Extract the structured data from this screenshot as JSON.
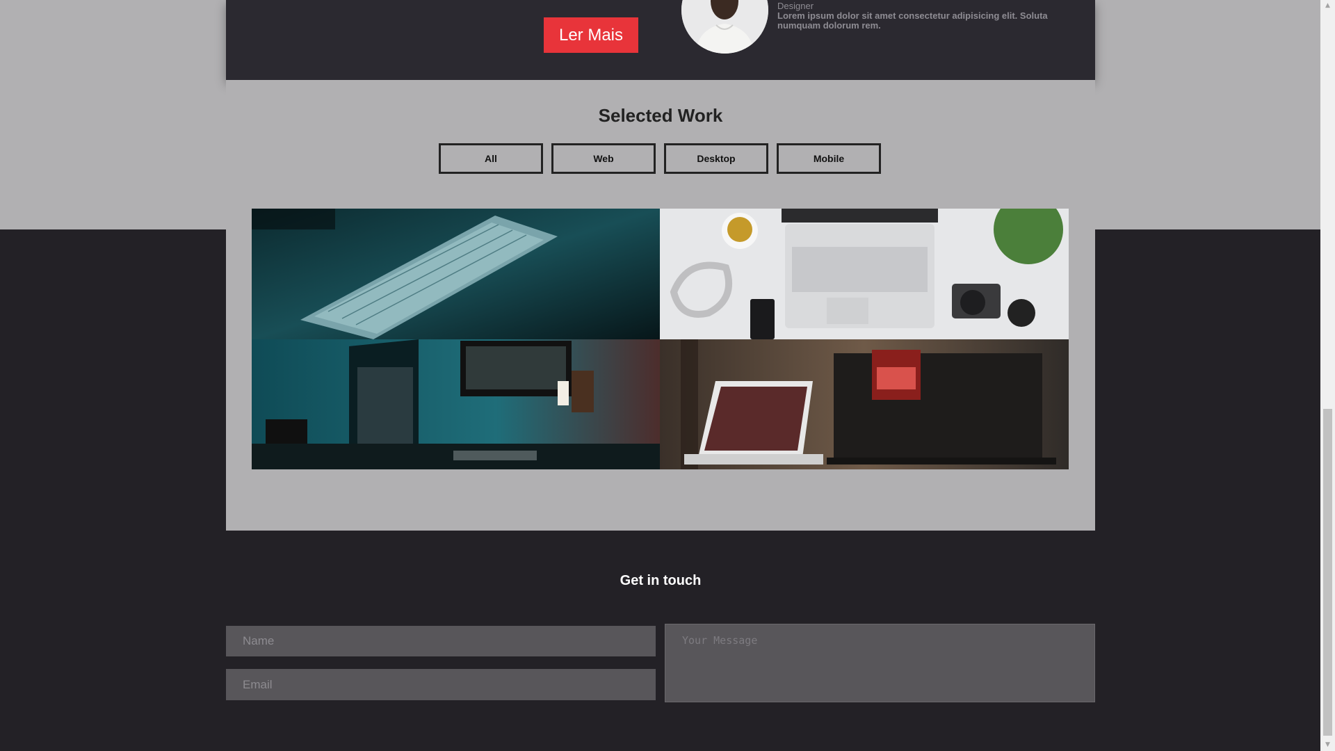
{
  "hero": {
    "read_more_label": "Ler Mais",
    "role": "Designer",
    "bio_text": "Lorem ipsum dolor sit amet consectetur adipisicing elit. Soluta numquam dolorum rem."
  },
  "work": {
    "title": "Selected Work",
    "filters": [
      "All",
      "Web",
      "Desktop",
      "Mobile"
    ],
    "items": [
      {
        "icon": "keyboard-photo"
      },
      {
        "icon": "laptop-desk-photo"
      },
      {
        "icon": "monitor-setup-photo"
      },
      {
        "icon": "laptop-open-sign-photo"
      }
    ]
  },
  "contact": {
    "title": "Get in touch",
    "name_placeholder": "Name",
    "email_placeholder": "Email",
    "message_placeholder": "Your Message"
  },
  "colors": {
    "accent": "#e8343a",
    "dark_bg": "#232126",
    "panel_bg": "#b1b0b2",
    "field_bg": "#58565a"
  }
}
